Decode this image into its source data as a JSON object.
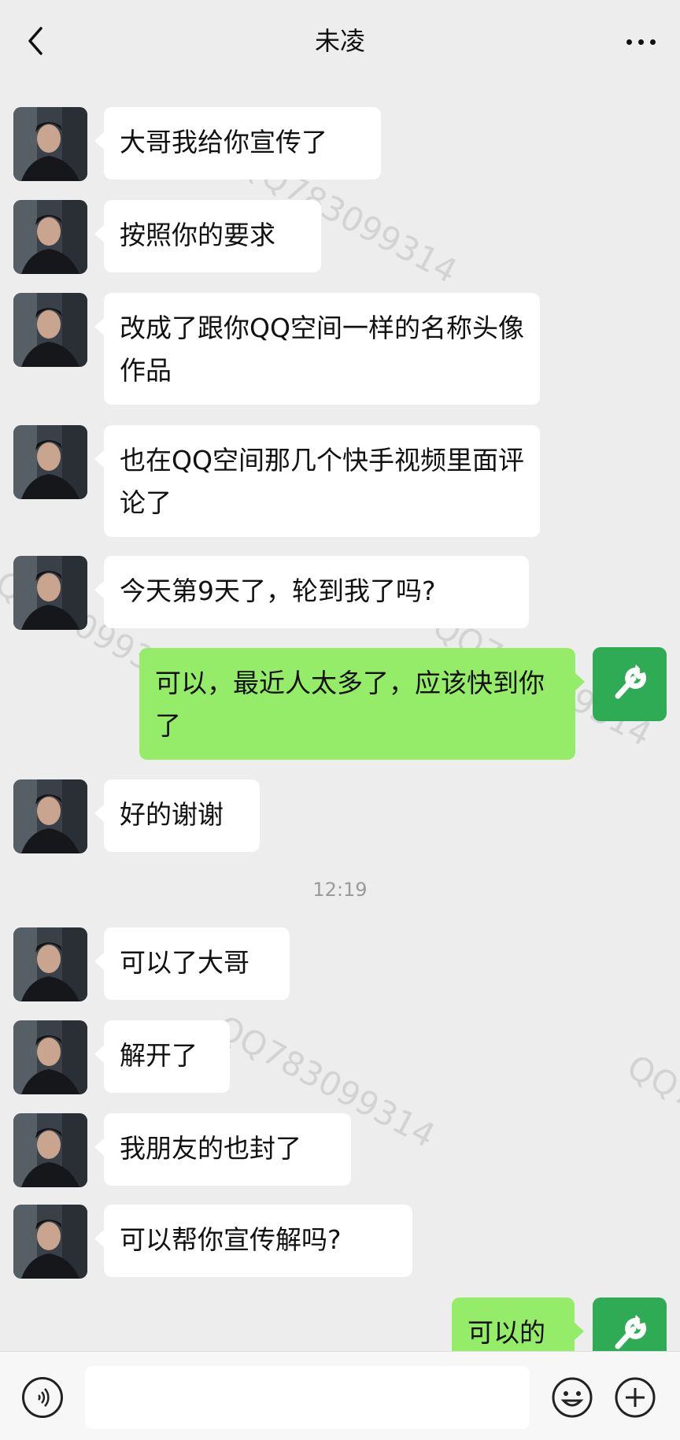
{
  "header": {
    "title": "未凌"
  },
  "watermark": "QQ783099314",
  "messages": [
    {
      "text": "大哥我给你宣传了"
    },
    {
      "text": "按照你的要求"
    },
    {
      "text": "改成了跟你QQ空间一样的名称头像作品"
    },
    {
      "text": "也在QQ空间那几个快手视频里面评论了"
    },
    {
      "text": "今天第9天了，轮到我了吗?"
    },
    {
      "text": "可以，最近人太多了，应该快到你了"
    },
    {
      "text": "好的谢谢"
    },
    {
      "text": "可以了大哥"
    },
    {
      "text": "解开了"
    },
    {
      "text": "我朋友的也封了"
    },
    {
      "text": "可以帮你宣传解吗?"
    },
    {
      "text": "可以的"
    }
  ],
  "timestamp": "12:19",
  "colors": {
    "background": "#ededed",
    "incoming_bubble": "#ffffff",
    "outgoing_bubble": "#95ec69",
    "my_avatar": "#2faa55"
  },
  "icons": {
    "back": "chevron-left-icon",
    "more": "more-dots-icon",
    "voice": "voice-icon",
    "emoji": "emoji-icon",
    "plus": "plus-icon",
    "my_avatar": "wrench-icon"
  }
}
